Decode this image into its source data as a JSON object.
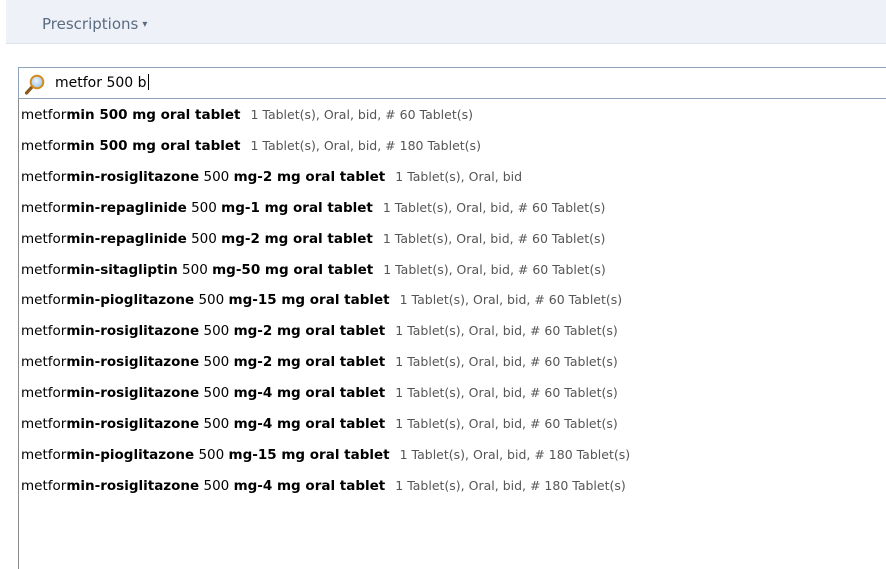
{
  "header": {
    "title": "Prescriptions",
    "caret": "▾"
  },
  "search": {
    "value": "metfor 500 b"
  },
  "results": [
    {
      "parts": [
        {
          "t": "metfor",
          "b": false
        },
        {
          "t": "min 500 ",
          "b": true
        },
        {
          "t": "mg oral tablet",
          "b": true
        }
      ],
      "sig": "1 Tablet(s), Oral, bid, # 60 Tablet(s)"
    },
    {
      "parts": [
        {
          "t": "metfor",
          "b": false
        },
        {
          "t": "min 500 ",
          "b": true
        },
        {
          "t": "mg oral tablet",
          "b": true
        }
      ],
      "sig": "1 Tablet(s), Oral, bid, # 180 Tablet(s)"
    },
    {
      "parts": [
        {
          "t": "metfor",
          "b": false
        },
        {
          "t": "min-rosiglitazone",
          "b": true
        },
        {
          "t": " 500 ",
          "b": false
        },
        {
          "t": "mg-2 mg oral tablet",
          "b": true
        }
      ],
      "sig": "1 Tablet(s), Oral, bid"
    },
    {
      "parts": [
        {
          "t": "metfor",
          "b": false
        },
        {
          "t": "min-repaglinide",
          "b": true
        },
        {
          "t": " 500 ",
          "b": false
        },
        {
          "t": "mg-1 mg oral tablet",
          "b": true
        }
      ],
      "sig": "1 Tablet(s), Oral, bid, # 60 Tablet(s)"
    },
    {
      "parts": [
        {
          "t": "metfor",
          "b": false
        },
        {
          "t": "min-repaglinide",
          "b": true
        },
        {
          "t": " 500 ",
          "b": false
        },
        {
          "t": "mg-2 mg oral tablet",
          "b": true
        }
      ],
      "sig": "1 Tablet(s), Oral, bid, # 60 Tablet(s)"
    },
    {
      "parts": [
        {
          "t": "metfor",
          "b": false
        },
        {
          "t": "min-sitagliptin",
          "b": true
        },
        {
          "t": " 500 ",
          "b": false
        },
        {
          "t": "mg-50 mg oral tablet",
          "b": true
        }
      ],
      "sig": "1 Tablet(s), Oral, bid, # 60 Tablet(s)"
    },
    {
      "parts": [
        {
          "t": "metfor",
          "b": false
        },
        {
          "t": "min-pioglitazone",
          "b": true
        },
        {
          "t": " 500 ",
          "b": false
        },
        {
          "t": "mg-15 mg oral tablet",
          "b": true
        }
      ],
      "sig": "1 Tablet(s), Oral, bid, # 60 Tablet(s)"
    },
    {
      "parts": [
        {
          "t": "metfor",
          "b": false
        },
        {
          "t": "min-rosiglitazone",
          "b": true
        },
        {
          "t": " 500 ",
          "b": false
        },
        {
          "t": "mg-2 mg oral tablet",
          "b": true
        }
      ],
      "sig": "1 Tablet(s), Oral, bid, # 60 Tablet(s)"
    },
    {
      "parts": [
        {
          "t": "metfor",
          "b": false
        },
        {
          "t": "min-rosiglitazone",
          "b": true
        },
        {
          "t": " 500 ",
          "b": false
        },
        {
          "t": "mg-2 mg oral tablet",
          "b": true
        }
      ],
      "sig": "1 Tablet(s), Oral, bid, # 60 Tablet(s)"
    },
    {
      "parts": [
        {
          "t": "metfor",
          "b": false
        },
        {
          "t": "min-rosiglitazone",
          "b": true
        },
        {
          "t": " 500 ",
          "b": false
        },
        {
          "t": "mg-4 mg oral tablet",
          "b": true
        }
      ],
      "sig": "1 Tablet(s), Oral, bid, # 60 Tablet(s)"
    },
    {
      "parts": [
        {
          "t": "metfor",
          "b": false
        },
        {
          "t": "min-rosiglitazone",
          "b": true
        },
        {
          "t": " 500 ",
          "b": false
        },
        {
          "t": "mg-4 mg oral tablet",
          "b": true
        }
      ],
      "sig": "1 Tablet(s), Oral, bid, # 60 Tablet(s)"
    },
    {
      "parts": [
        {
          "t": "metfor",
          "b": false
        },
        {
          "t": "min-pioglitazone",
          "b": true
        },
        {
          "t": " 500 ",
          "b": false
        },
        {
          "t": "mg-15 mg oral tablet",
          "b": true
        }
      ],
      "sig": "1 Tablet(s), Oral, bid, # 180 Tablet(s)"
    },
    {
      "parts": [
        {
          "t": "metfor",
          "b": false
        },
        {
          "t": "min-rosiglitazone",
          "b": true
        },
        {
          "t": " 500 ",
          "b": false
        },
        {
          "t": "mg-4 mg oral tablet",
          "b": true
        }
      ],
      "sig": "1 Tablet(s), Oral, bid, # 180 Tablet(s)"
    }
  ],
  "icons": {
    "search": "search-icon",
    "dropdown": "chevron-down-icon"
  },
  "colors": {
    "header_bg": "#eef2f8",
    "header_text": "#5a6b80",
    "search_border": "#8fa3bd",
    "search_icon_ring": "#d68a1c",
    "search_icon_handle": "#8a5a18"
  }
}
